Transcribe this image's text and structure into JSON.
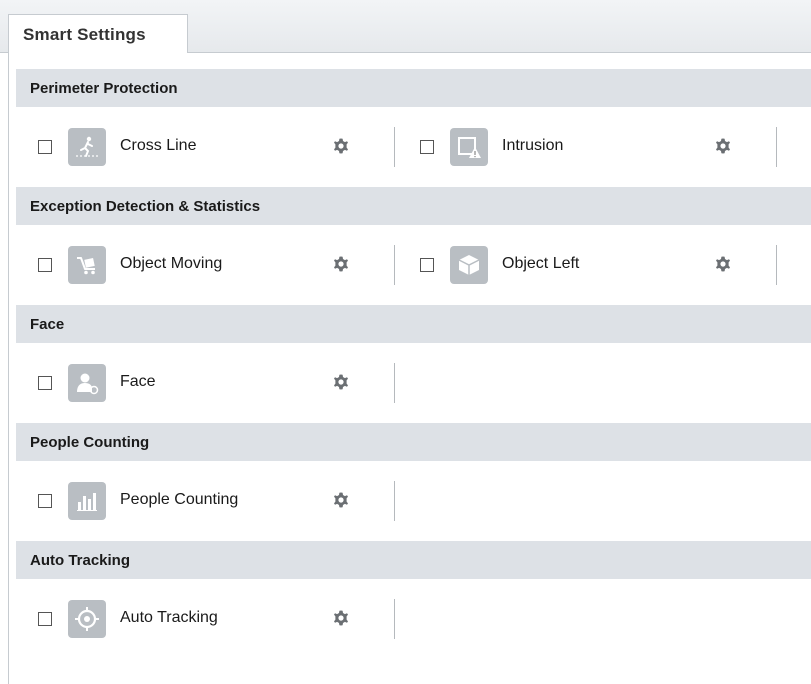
{
  "tab": {
    "label": "Smart Settings"
  },
  "sections": [
    {
      "title": "Perimeter Protection",
      "items": [
        {
          "label": "Cross Line",
          "icon": "cross-line-icon",
          "checked": false
        },
        {
          "label": "Intrusion",
          "icon": "intrusion-icon",
          "checked": false
        }
      ]
    },
    {
      "title": "Exception Detection & Statistics",
      "items": [
        {
          "label": "Object Moving",
          "icon": "object-moving-icon",
          "checked": false
        },
        {
          "label": "Object Left",
          "icon": "object-left-icon",
          "checked": false
        }
      ]
    },
    {
      "title": "Face",
      "items": [
        {
          "label": "Face",
          "icon": "face-icon",
          "checked": false
        }
      ]
    },
    {
      "title": "People Counting",
      "items": [
        {
          "label": "People Counting",
          "icon": "people-counting-icon",
          "checked": false
        }
      ]
    },
    {
      "title": "Auto Tracking",
      "items": [
        {
          "label": "Auto Tracking",
          "icon": "auto-tracking-icon",
          "checked": false
        }
      ]
    }
  ],
  "colors": {
    "section_bg": "#dde1e6",
    "icon_bg": "#b9bec3",
    "gear": "#6b6f73",
    "accent_orange": "#d9784a"
  }
}
